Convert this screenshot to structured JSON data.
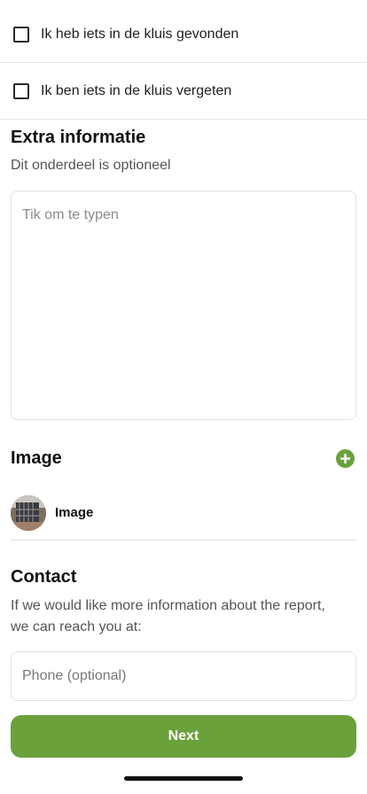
{
  "checkboxes": [
    {
      "label": "Ik heb iets in de kluis gevonden",
      "checked": false
    },
    {
      "label": "Ik ben iets in de kluis vergeten",
      "checked": false
    }
  ],
  "extra": {
    "title": "Extra informatie",
    "subtitle": "Dit onderdeel is optioneel",
    "placeholder": "Tik om te typen"
  },
  "image_section": {
    "title": "Image",
    "add_icon": "plus-circle-icon",
    "item_label": "Image"
  },
  "contact": {
    "title": "Contact",
    "description_line1": "If we would like more information about the report,",
    "description_line2": "we can reach you at:",
    "phone_placeholder": "Phone (optional)"
  },
  "next_label": "Next",
  "colors": {
    "accent": "#6aa13b",
    "border": "#e0e0e0"
  }
}
